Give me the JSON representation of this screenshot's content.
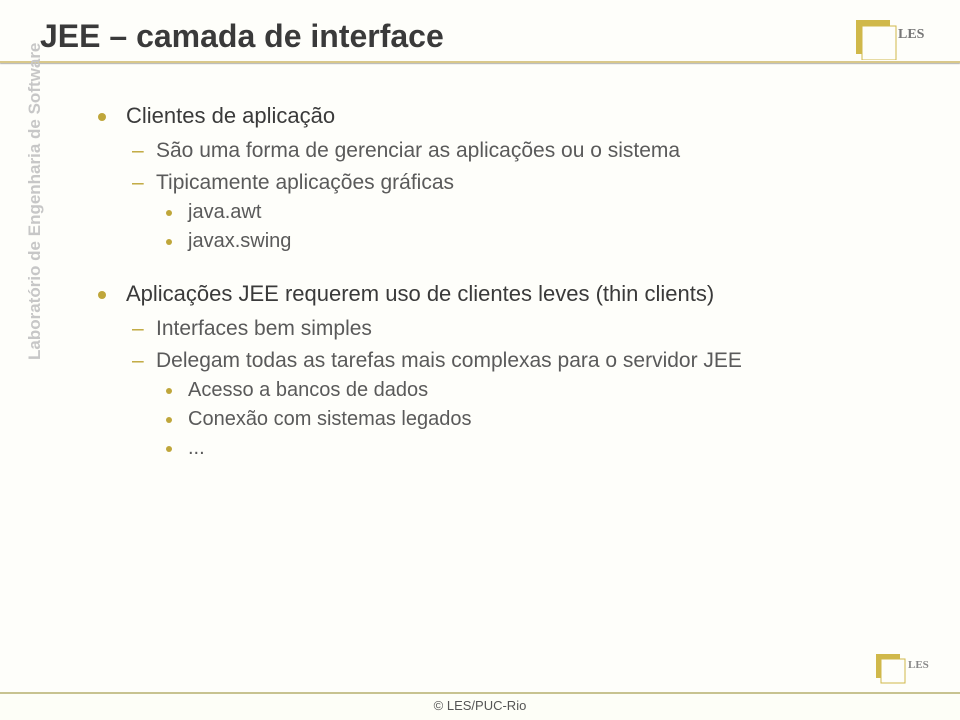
{
  "title": "JEE – camada de interface",
  "sidebar": "Laboratório de Engenharia de Software",
  "footer": "© LES/PUC-Rio",
  "logo_text": "LES",
  "bullets": {
    "b1": {
      "text": "Clientes de aplicação",
      "sub1": "São uma forma de gerenciar as aplicações ou o sistema",
      "sub2": "Tipicamente aplicações gráficas",
      "sub2a": "java.awt",
      "sub2b": "javax.swing"
    },
    "b2": {
      "text": "Aplicações JEE requerem uso de clientes leves (thin clients)",
      "sub1": "Interfaces bem simples",
      "sub2": "Delegam todas as tarefas mais complexas para o servidor JEE",
      "sub2a": "Acesso a bancos de dados",
      "sub2b": "Conexão com sistemas legados",
      "sub2c": "..."
    }
  }
}
